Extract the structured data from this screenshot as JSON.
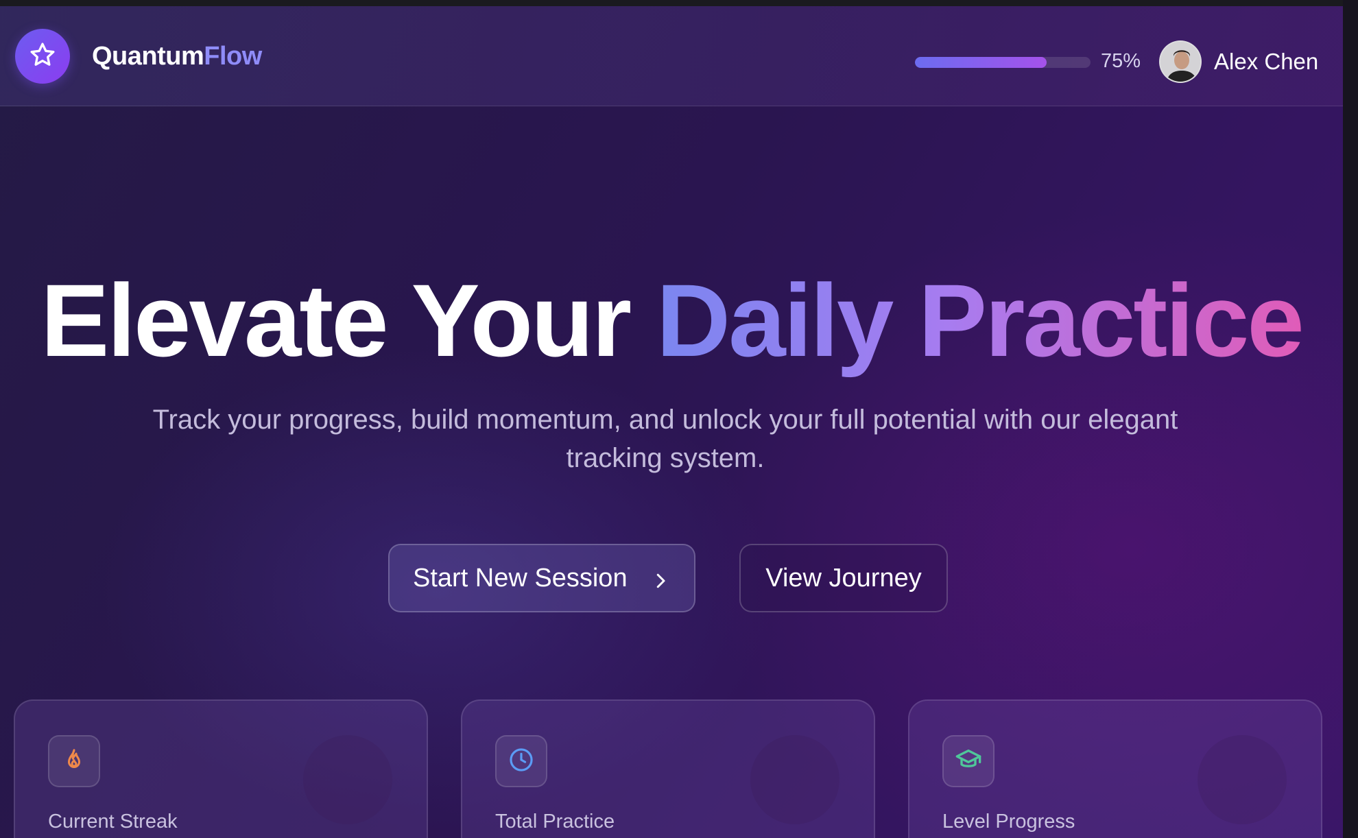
{
  "app": {
    "brand_main": "Quantum",
    "brand_accent": "Flow",
    "logo_icon": "star-icon"
  },
  "header": {
    "progress_fraction": 0.75,
    "progress_label": "75%",
    "user_name": "Alex Chen",
    "avatar_icon": "user-avatar"
  },
  "hero": {
    "title_plain": "Elevate Your ",
    "title_gradient": "Daily Practice",
    "subtitle": "Track your progress, build momentum, and unlock your full potential with our elegant tracking system."
  },
  "actions": {
    "primary_label": "Start New Session",
    "primary_icon": "chevron-right-icon",
    "secondary_label": "View Journey"
  },
  "cards": [
    {
      "label": "Current Streak",
      "icon": "flame-icon",
      "icon_color": "#f0894a"
    },
    {
      "label": "Total Practice",
      "icon": "clock-icon",
      "icon_color": "#5b9cf5"
    },
    {
      "label": "Level Progress",
      "icon": "graduation-cap-icon",
      "icon_color": "#4fc79a"
    }
  ],
  "colors": {
    "accent": "#8f8cf8",
    "progress_start": "#6c6cf0",
    "progress_end": "#a552ea"
  }
}
